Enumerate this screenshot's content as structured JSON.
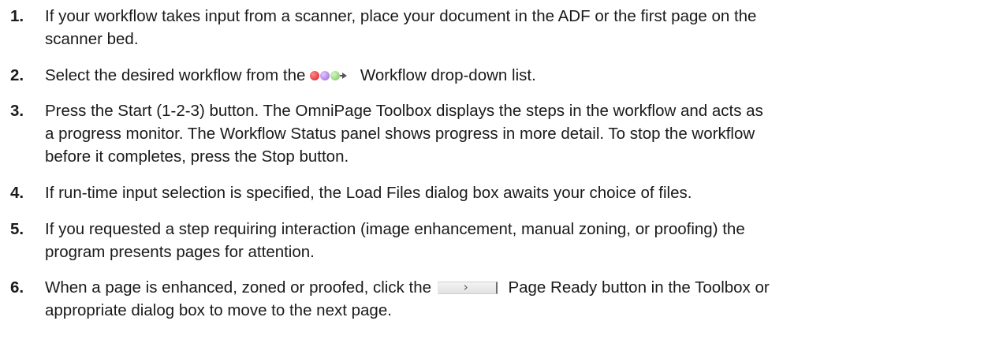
{
  "steps": [
    {
      "number": "1.",
      "lines": [
        "If your workflow takes input from a scanner, place your document in the ADF or the first page on the",
        "scanner bed."
      ]
    },
    {
      "number": "2.",
      "before": "Select the desired workflow from the",
      "icon": "workflow-dots-icon",
      "after": "Workflow drop-down list."
    },
    {
      "number": "3.",
      "lines": [
        "Press the Start (1-2-3) button. The OmniPage Toolbox displays the steps in the workflow and acts as",
        "a progress monitor. The Workflow Status panel shows progress in more detail. To stop the workflow",
        "before it completes, press the Stop button."
      ]
    },
    {
      "number": "4.",
      "lines": [
        "If run-time input selection is specified, the Load Files dialog box awaits your choice of files."
      ]
    },
    {
      "number": "5.",
      "lines": [
        "If you requested a step requiring interaction (image enhancement, manual zoning, or proofing) the",
        "program presents pages for attention."
      ]
    },
    {
      "number": "6.",
      "before": "When a page is enhanced, zoned or proofed, click the",
      "button_glyph": "›",
      "after": "Page Ready button in the Toolbox or",
      "line2": "appropriate dialog box to move to the next page."
    }
  ],
  "colors": {
    "text": "#1a1a1a",
    "dot_red": "#d81b1b",
    "dot_purple": "#9a5ed8",
    "dot_green": "#76c25a"
  }
}
